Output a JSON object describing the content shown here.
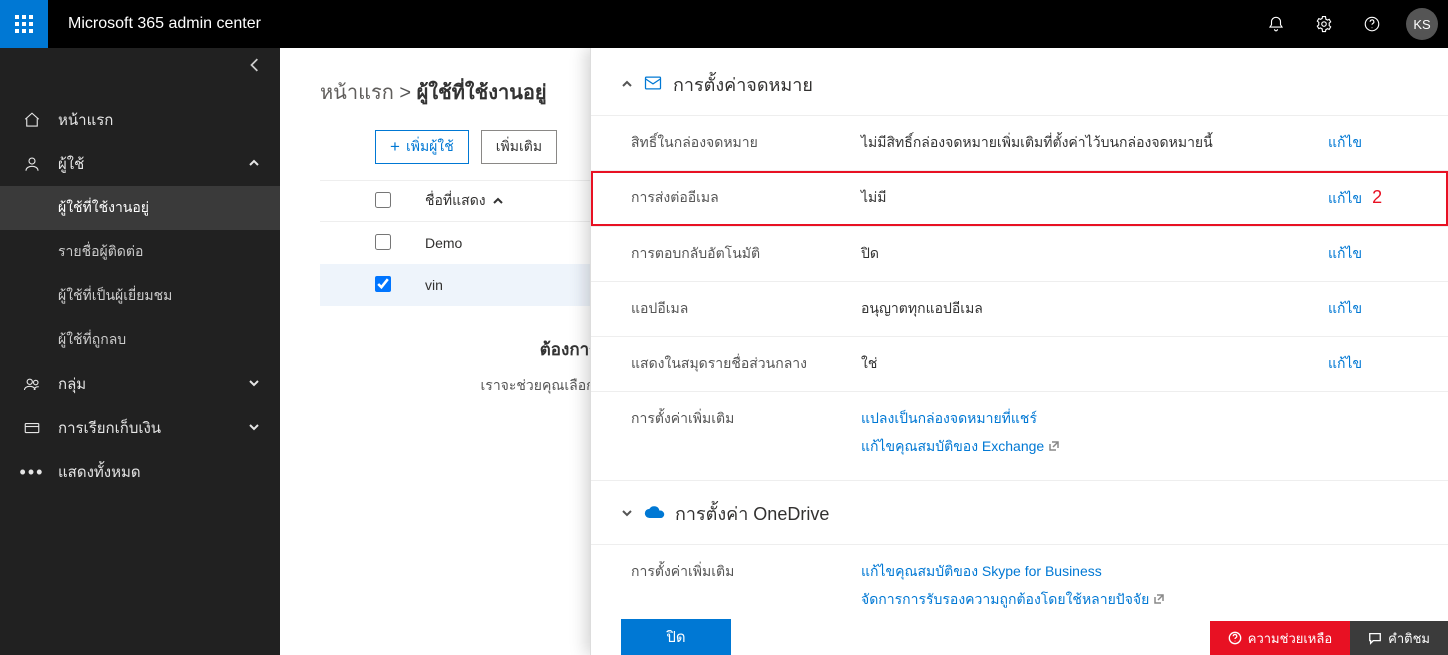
{
  "header": {
    "app_title": "Microsoft 365 admin center",
    "avatar_initials": "KS"
  },
  "sidebar": {
    "home": "หน้าแรก",
    "users": "ผู้ใช้",
    "users_sub": [
      "ผู้ใช้ที่ใช้งานอยู่",
      "รายชื่อผู้ติดต่อ",
      "ผู้ใช้ที่เป็นผู้เยี่ยมชม",
      "ผู้ใช้ที่ถูกลบ"
    ],
    "groups": "กลุ่ม",
    "billing": "การเรียกเก็บเงิน",
    "show_all": "แสดงทั้งหมด"
  },
  "main": {
    "breadcrumb_home": "หน้าแรก",
    "breadcrumb_sep": " > ",
    "breadcrumb_current": "ผู้ใช้ที่ใช้งานอยู่",
    "add_user": "เพิ่มผู้ใช้",
    "more": "เพิ่มเติม",
    "col_displayname": "ชื่อที่แสดง",
    "rows": [
      "Demo",
      "vin"
    ],
    "selected_index": 1,
    "hint_title": "ต้องการเพิ่มแค่ที่อยู่",
    "hint_text": "เราจะช่วยคุณเลือกตัวเลือกที่ถูกต้องของคุณ"
  },
  "panel": {
    "mail_section_title": "การตั้งค่าจดหมาย",
    "rows": [
      {
        "label": "สิทธิ์ในกล่องจดหมาย",
        "value": "ไม่มีสิทธิ์กล่องจดหมายเพิ่มเติมที่ตั้งค่าไว้บนกล่องจดหมายนี้",
        "action": "แก้ไข"
      },
      {
        "label": "การส่งต่ออีเมล",
        "value": "ไม่มี",
        "action": "แก้ไข",
        "highlight": true,
        "badge": "2"
      },
      {
        "label": "การตอบกลับอัตโนมัติ",
        "value": "ปิด",
        "action": "แก้ไข"
      },
      {
        "label": "แอปอีเมล",
        "value": "อนุญาตทุกแอปอีเมล",
        "action": "แก้ไข"
      },
      {
        "label": "แสดงในสมุดรายชื่อส่วนกลาง",
        "value": "ใช่",
        "action": "แก้ไข"
      }
    ],
    "more_settings_label": "การตั้งค่าเพิ่มเติม",
    "more_links": [
      "แปลงเป็นกล่องจดหมายที่แชร์",
      "แก้ไขคุณสมบัติของ Exchange"
    ],
    "onedrive_section_title": "การตั้งค่า OneDrive",
    "od_more_label": "การตั้งค่าเพิ่มเติม",
    "od_links": [
      "แก้ไขคุณสมบัติของ Skype for Business",
      "จัดการการรับรองความถูกต้องโดยใช้หลายปัจจัย"
    ],
    "close_btn": "ปิด",
    "help_btn": "ความช่วยเหลือ",
    "feedback_btn": "คำติชม"
  }
}
